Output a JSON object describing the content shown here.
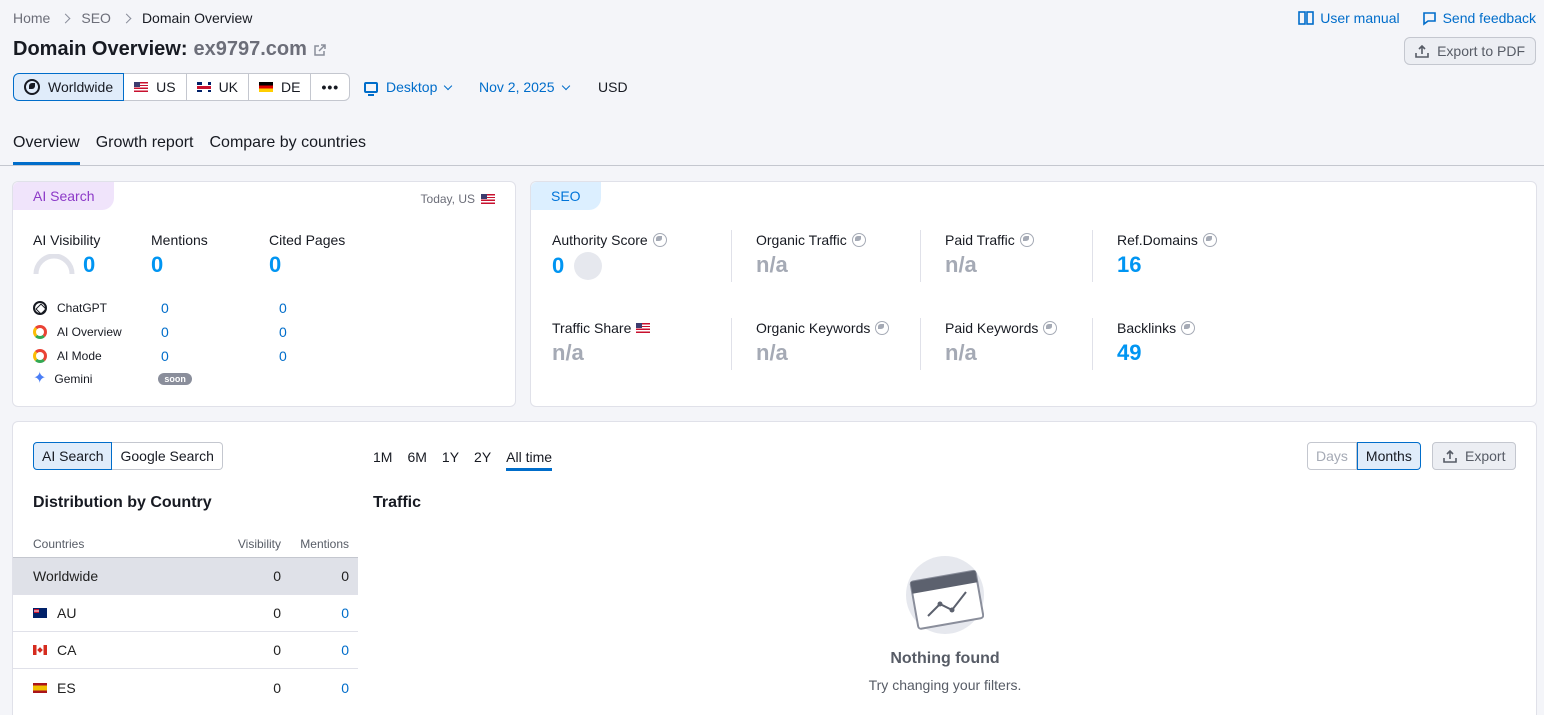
{
  "breadcrumb": [
    "Home",
    "SEO",
    "Domain Overview"
  ],
  "top_links": {
    "manual": "User manual",
    "feedback": "Send feedback"
  },
  "page": {
    "title_prefix": "Domain Overview:",
    "domain": "ex9797.com",
    "export_pdf": "Export to PDF"
  },
  "databases": {
    "worldwide": "Worldwide",
    "us": "US",
    "uk": "UK",
    "de": "DE",
    "more": "•••"
  },
  "filters": {
    "device": "Desktop",
    "date": "Nov 2, 2025",
    "currency": "USD"
  },
  "tabs": [
    "Overview",
    "Growth report",
    "Compare by countries"
  ],
  "ai_card": {
    "pill": "AI Search",
    "updated": "Today, US",
    "metrics": [
      {
        "label": "AI Visibility",
        "value": "0"
      },
      {
        "label": "Mentions",
        "value": "0"
      },
      {
        "label": "Cited Pages",
        "value": "0"
      }
    ],
    "sources": [
      {
        "name": "ChatGPT",
        "mentions": "0",
        "cited": "0"
      },
      {
        "name": "AI Overview",
        "mentions": "0",
        "cited": "0"
      },
      {
        "name": "AI Mode",
        "mentions": "0",
        "cited": "0"
      },
      {
        "name": "Gemini",
        "badge": "soon"
      }
    ]
  },
  "seo_card": {
    "pill": "SEO",
    "metrics": [
      {
        "label": "Authority Score",
        "value": "0"
      },
      {
        "label": "Organic Traffic",
        "value": "n/a"
      },
      {
        "label": "Paid Traffic",
        "value": "n/a"
      },
      {
        "label": "Ref.Domains",
        "value": "16"
      },
      {
        "label": "Traffic Share",
        "value": "n/a"
      },
      {
        "label": "Organic Keywords",
        "value": "n/a"
      },
      {
        "label": "Paid Keywords",
        "value": "n/a"
      },
      {
        "label": "Backlinks",
        "value": "49"
      }
    ]
  },
  "bottom": {
    "source_toggle": [
      "AI Search",
      "Google Search"
    ],
    "ranges": [
      "1M",
      "6M",
      "1Y",
      "2Y",
      "All time"
    ],
    "granularity": [
      "Days",
      "Months"
    ],
    "export": "Export",
    "dist_title": "Distribution by Country",
    "traffic_title": "Traffic",
    "columns": [
      "Countries",
      "Visibility",
      "Mentions"
    ],
    "rows": [
      {
        "country": "Worldwide",
        "visibility": "0",
        "mentions": "0"
      },
      {
        "country": "AU",
        "visibility": "0",
        "mentions": "0"
      },
      {
        "country": "CA",
        "visibility": "0",
        "mentions": "0"
      },
      {
        "country": "ES",
        "visibility": "0",
        "mentions": "0"
      }
    ],
    "empty_title": "Nothing found",
    "empty_sub": "Try changing your filters."
  }
}
